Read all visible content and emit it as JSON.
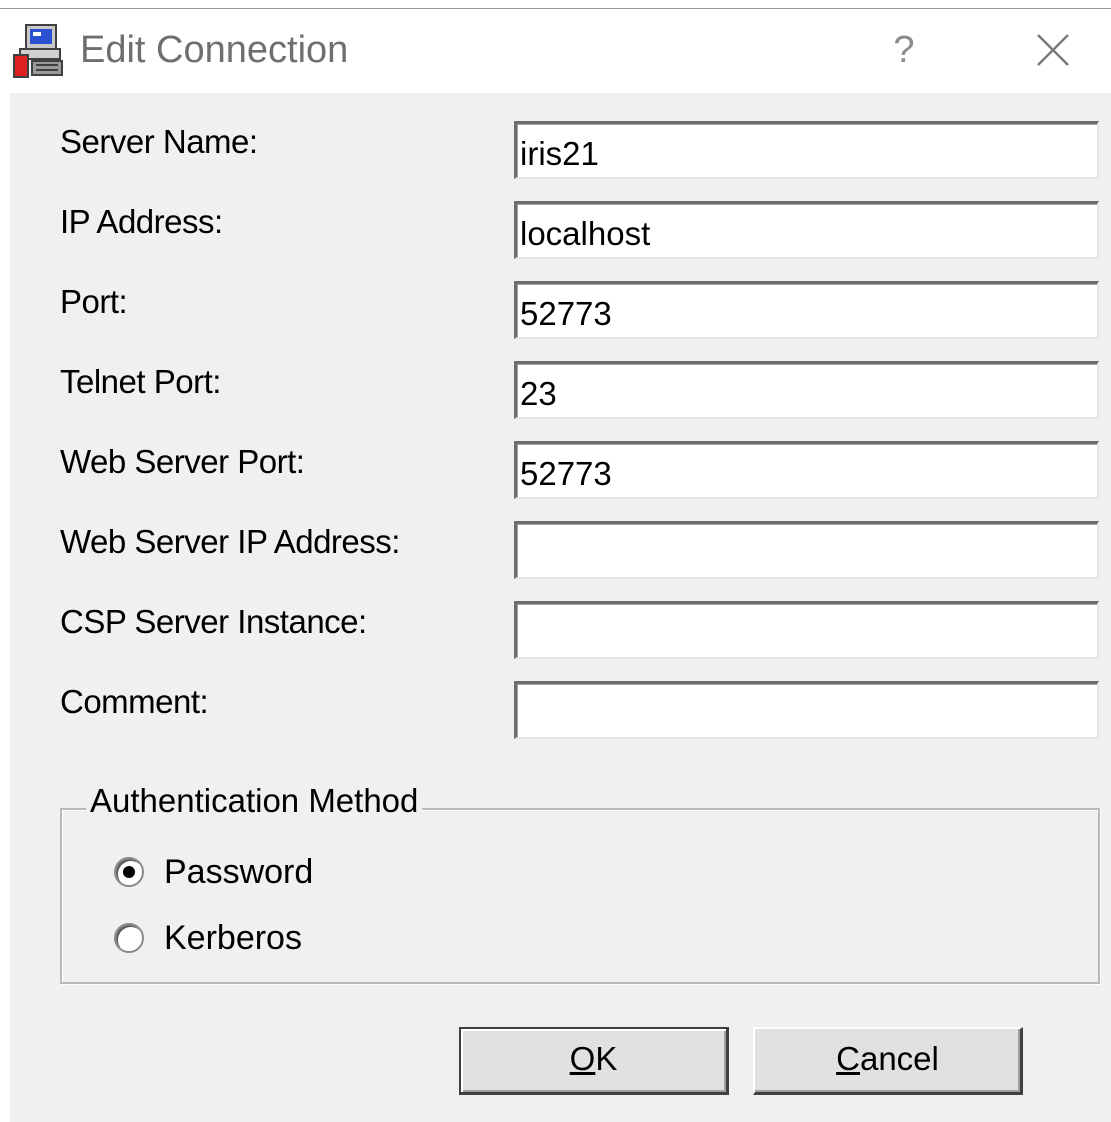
{
  "window": {
    "title": "Edit Connection",
    "help_glyph": "?",
    "close_glyph": "✕",
    "icon": "connection-app-icon"
  },
  "fields": [
    {
      "label": "Server Name:",
      "value": "iris21"
    },
    {
      "label": "IP Address:",
      "value": "localhost"
    },
    {
      "label": "Port:",
      "value": "52773"
    },
    {
      "label": "Telnet Port:",
      "value": "23"
    },
    {
      "label": "Web Server Port:",
      "value": "52773"
    },
    {
      "label": "Web Server IP Address:",
      "value": ""
    },
    {
      "label": "CSP Server Instance:",
      "value": ""
    },
    {
      "label": "Comment:",
      "value": ""
    }
  ],
  "auth": {
    "group_title": "Authentication Method",
    "options": [
      {
        "label": "Password",
        "selected": true
      },
      {
        "label": "Kerberos",
        "selected": false
      }
    ]
  },
  "buttons": {
    "ok": {
      "mnemonic": "O",
      "rest": "K"
    },
    "cancel": {
      "mnemonic": "C",
      "rest": "ancel"
    }
  }
}
